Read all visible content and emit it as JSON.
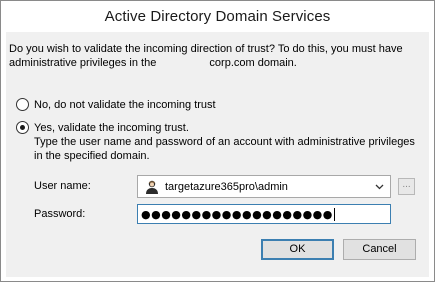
{
  "window": {
    "title": "Active Directory Domain Services"
  },
  "question": {
    "prefix": "Do you wish to validate the incoming direction of trust? To do this, you must have administrative privileges in the",
    "suffix": "corp.com domain."
  },
  "options": {
    "no_label": "No, do not validate the incoming trust",
    "yes_label": "Yes, validate the incoming trust.",
    "selected": "yes"
  },
  "instructions": "Type the user name and password of an account with administrative privileges in the specified domain.",
  "form": {
    "username_label": "User name:",
    "username_value": "targetazure365pro\\admin",
    "password_label": "Password:",
    "password_masked": "●●●●●●●●●●●●●●●●●●●"
  },
  "buttons": {
    "ok": "OK",
    "cancel": "Cancel",
    "browse": "..."
  },
  "icons": {
    "user_icon": "user-icon",
    "dropdown_icon": "chevron-down-icon"
  }
}
